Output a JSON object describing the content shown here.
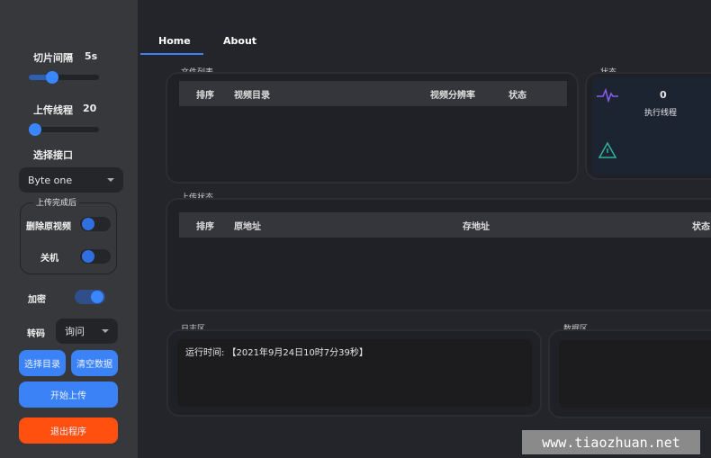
{
  "sidebar": {
    "slice_interval_label": "切片间隔",
    "slice_interval_value": "5s",
    "slice_interval_fraction": 0.33,
    "upload_threads_label": "上传线程",
    "upload_threads_value": "20",
    "upload_threads_fraction": 0.05,
    "interface_label": "选择接口",
    "interface_value": "Byte one",
    "after_upload_group": "上传完成后",
    "delete_source_label": "删除原视频",
    "delete_source_on": false,
    "shutdown_label": "关机",
    "shutdown_on": false,
    "encrypt_label": "加密",
    "encrypt_on": true,
    "transcode_label": "转码",
    "transcode_value": "询问",
    "select_dir": "选择目录",
    "clear_data": "清空数据",
    "start_upload": "开始上传",
    "exit": "退出程序"
  },
  "tabs": [
    {
      "label": "Home",
      "active": true
    },
    {
      "label": "About",
      "active": false
    }
  ],
  "file_list": {
    "title": "文件列表",
    "columns": [
      "排序",
      "视频目录",
      "视频分辨率",
      "状态"
    ]
  },
  "status": {
    "title": "状态",
    "threads_value": "0",
    "threads_label": "执行线程"
  },
  "upload_status": {
    "title": "上传状态",
    "columns": [
      "排序",
      "原地址",
      "存地址",
      "状态"
    ]
  },
  "log": {
    "title": "日志区",
    "text": "运行时间: 【2021年9月24日10时7分39秒】"
  },
  "data_area": {
    "title": "数据区"
  },
  "watermark": "www.tiaozhuan.net",
  "colors": {
    "accent": "#3a82f6",
    "danger": "#ff5010"
  }
}
